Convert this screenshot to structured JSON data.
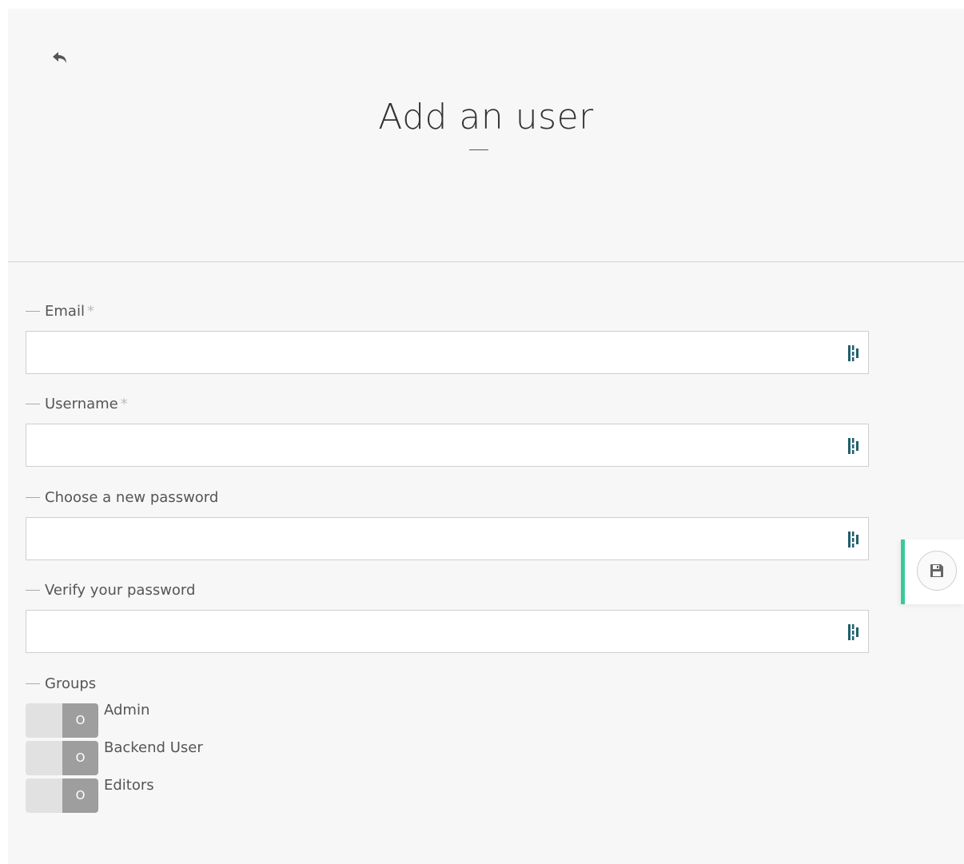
{
  "header": {
    "title": "Add an user",
    "back_icon": "reply-arrow-icon"
  },
  "form": {
    "fields": [
      {
        "label": "Email",
        "required_mark": "*",
        "value": "",
        "placeholder": ""
      },
      {
        "label": "Username",
        "required_mark": "*",
        "value": "",
        "placeholder": ""
      },
      {
        "label": "Choose a new password",
        "required_mark": "",
        "value": "",
        "placeholder": ""
      },
      {
        "label": "Verify your password",
        "required_mark": "",
        "value": "",
        "placeholder": ""
      }
    ],
    "password_manager_icon": "password-manager-icon",
    "groups_label": "Groups",
    "groups": [
      {
        "label": "Admin",
        "toggle_text": "O",
        "enabled": false
      },
      {
        "label": "Backend User",
        "toggle_text": "O",
        "enabled": false
      },
      {
        "label": "Editors",
        "toggle_text": "O",
        "enabled": false
      }
    ]
  },
  "actions": {
    "save_icon": "floppy-disk-icon"
  },
  "colors": {
    "accent": "#3cc89a",
    "page_bg": "#f7f7f7",
    "toggle_knob": "#9e9e9e",
    "toggle_track": "#e1e1e1",
    "pw_icon": "#1f5f6b"
  }
}
